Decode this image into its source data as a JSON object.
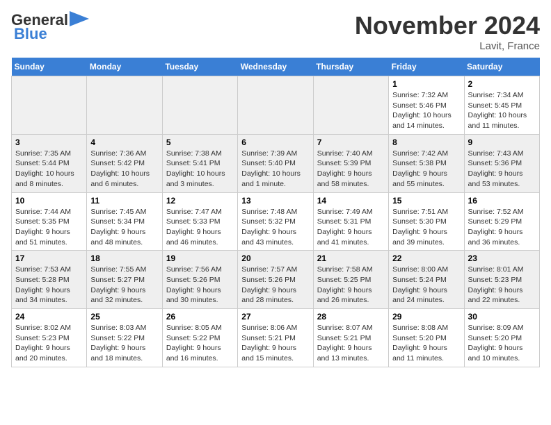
{
  "header": {
    "logo_line1": "General",
    "logo_line2": "Blue",
    "month_title": "November 2024",
    "location": "Lavit, France"
  },
  "weekdays": [
    "Sunday",
    "Monday",
    "Tuesday",
    "Wednesday",
    "Thursday",
    "Friday",
    "Saturday"
  ],
  "weeks": [
    [
      {
        "day": "",
        "info": ""
      },
      {
        "day": "",
        "info": ""
      },
      {
        "day": "",
        "info": ""
      },
      {
        "day": "",
        "info": ""
      },
      {
        "day": "",
        "info": ""
      },
      {
        "day": "1",
        "info": "Sunrise: 7:32 AM\nSunset: 5:46 PM\nDaylight: 10 hours\nand 14 minutes."
      },
      {
        "day": "2",
        "info": "Sunrise: 7:34 AM\nSunset: 5:45 PM\nDaylight: 10 hours\nand 11 minutes."
      }
    ],
    [
      {
        "day": "3",
        "info": "Sunrise: 7:35 AM\nSunset: 5:44 PM\nDaylight: 10 hours\nand 8 minutes."
      },
      {
        "day": "4",
        "info": "Sunrise: 7:36 AM\nSunset: 5:42 PM\nDaylight: 10 hours\nand 6 minutes."
      },
      {
        "day": "5",
        "info": "Sunrise: 7:38 AM\nSunset: 5:41 PM\nDaylight: 10 hours\nand 3 minutes."
      },
      {
        "day": "6",
        "info": "Sunrise: 7:39 AM\nSunset: 5:40 PM\nDaylight: 10 hours\nand 1 minute."
      },
      {
        "day": "7",
        "info": "Sunrise: 7:40 AM\nSunset: 5:39 PM\nDaylight: 9 hours\nand 58 minutes."
      },
      {
        "day": "8",
        "info": "Sunrise: 7:42 AM\nSunset: 5:38 PM\nDaylight: 9 hours\nand 55 minutes."
      },
      {
        "day": "9",
        "info": "Sunrise: 7:43 AM\nSunset: 5:36 PM\nDaylight: 9 hours\nand 53 minutes."
      }
    ],
    [
      {
        "day": "10",
        "info": "Sunrise: 7:44 AM\nSunset: 5:35 PM\nDaylight: 9 hours\nand 51 minutes."
      },
      {
        "day": "11",
        "info": "Sunrise: 7:45 AM\nSunset: 5:34 PM\nDaylight: 9 hours\nand 48 minutes."
      },
      {
        "day": "12",
        "info": "Sunrise: 7:47 AM\nSunset: 5:33 PM\nDaylight: 9 hours\nand 46 minutes."
      },
      {
        "day": "13",
        "info": "Sunrise: 7:48 AM\nSunset: 5:32 PM\nDaylight: 9 hours\nand 43 minutes."
      },
      {
        "day": "14",
        "info": "Sunrise: 7:49 AM\nSunset: 5:31 PM\nDaylight: 9 hours\nand 41 minutes."
      },
      {
        "day": "15",
        "info": "Sunrise: 7:51 AM\nSunset: 5:30 PM\nDaylight: 9 hours\nand 39 minutes."
      },
      {
        "day": "16",
        "info": "Sunrise: 7:52 AM\nSunset: 5:29 PM\nDaylight: 9 hours\nand 36 minutes."
      }
    ],
    [
      {
        "day": "17",
        "info": "Sunrise: 7:53 AM\nSunset: 5:28 PM\nDaylight: 9 hours\nand 34 minutes."
      },
      {
        "day": "18",
        "info": "Sunrise: 7:55 AM\nSunset: 5:27 PM\nDaylight: 9 hours\nand 32 minutes."
      },
      {
        "day": "19",
        "info": "Sunrise: 7:56 AM\nSunset: 5:26 PM\nDaylight: 9 hours\nand 30 minutes."
      },
      {
        "day": "20",
        "info": "Sunrise: 7:57 AM\nSunset: 5:26 PM\nDaylight: 9 hours\nand 28 minutes."
      },
      {
        "day": "21",
        "info": "Sunrise: 7:58 AM\nSunset: 5:25 PM\nDaylight: 9 hours\nand 26 minutes."
      },
      {
        "day": "22",
        "info": "Sunrise: 8:00 AM\nSunset: 5:24 PM\nDaylight: 9 hours\nand 24 minutes."
      },
      {
        "day": "23",
        "info": "Sunrise: 8:01 AM\nSunset: 5:23 PM\nDaylight: 9 hours\nand 22 minutes."
      }
    ],
    [
      {
        "day": "24",
        "info": "Sunrise: 8:02 AM\nSunset: 5:23 PM\nDaylight: 9 hours\nand 20 minutes."
      },
      {
        "day": "25",
        "info": "Sunrise: 8:03 AM\nSunset: 5:22 PM\nDaylight: 9 hours\nand 18 minutes."
      },
      {
        "day": "26",
        "info": "Sunrise: 8:05 AM\nSunset: 5:22 PM\nDaylight: 9 hours\nand 16 minutes."
      },
      {
        "day": "27",
        "info": "Sunrise: 8:06 AM\nSunset: 5:21 PM\nDaylight: 9 hours\nand 15 minutes."
      },
      {
        "day": "28",
        "info": "Sunrise: 8:07 AM\nSunset: 5:21 PM\nDaylight: 9 hours\nand 13 minutes."
      },
      {
        "day": "29",
        "info": "Sunrise: 8:08 AM\nSunset: 5:20 PM\nDaylight: 9 hours\nand 11 minutes."
      },
      {
        "day": "30",
        "info": "Sunrise: 8:09 AM\nSunset: 5:20 PM\nDaylight: 9 hours\nand 10 minutes."
      }
    ]
  ]
}
